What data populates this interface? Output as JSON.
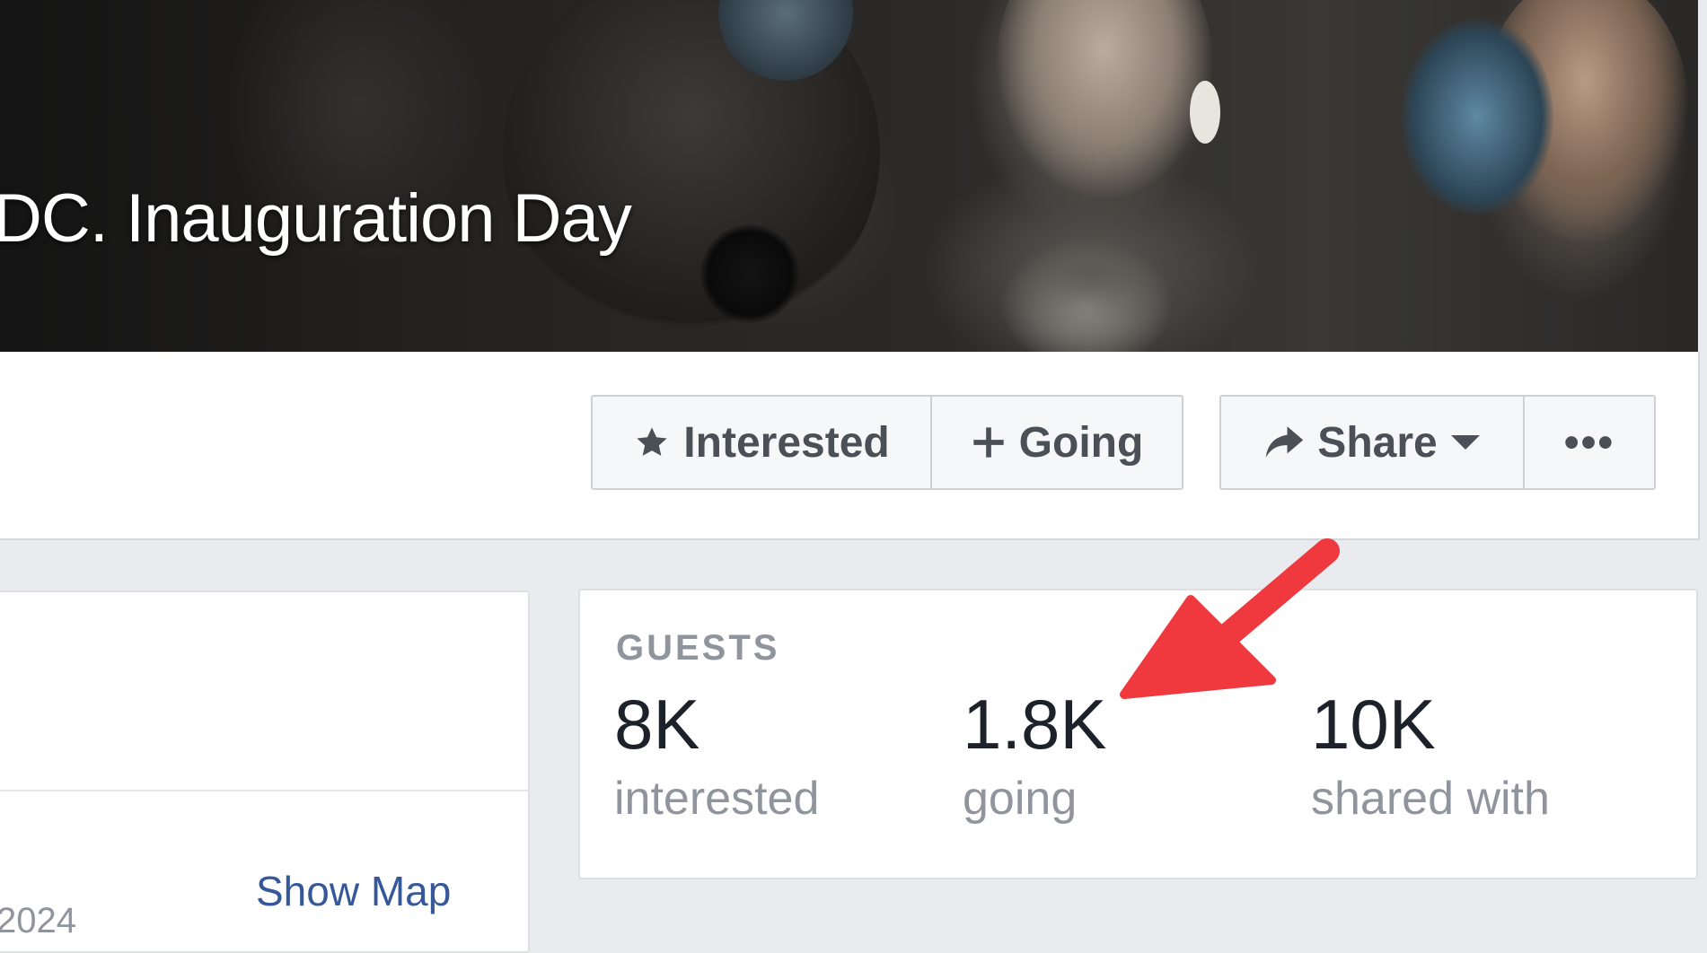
{
  "event": {
    "title": "DC. Inauguration Day"
  },
  "actions": {
    "interested_label": "Interested",
    "going_label": "Going",
    "share_label": "Share",
    "more_label": "•••"
  },
  "details": {
    "show_map_label": "Show Map",
    "partial_date": "2024"
  },
  "guests": {
    "heading": "GUESTS",
    "stats": [
      {
        "value": "8K",
        "label": "interested"
      },
      {
        "value": "1.8K",
        "label": "going"
      },
      {
        "value": "10K",
        "label": "shared with"
      }
    ]
  },
  "annotation": {
    "arrow_color": "#f0393f"
  },
  "icons": {
    "interested": "star-icon",
    "going": "plus-icon",
    "share": "share-arrow-icon",
    "share_menu": "caret-down-icon",
    "more": "ellipsis-icon"
  },
  "colors": {
    "button_text": "#4b4f56",
    "link": "#365899",
    "muted": "#90949c",
    "page_bg": "#e9ebee"
  }
}
